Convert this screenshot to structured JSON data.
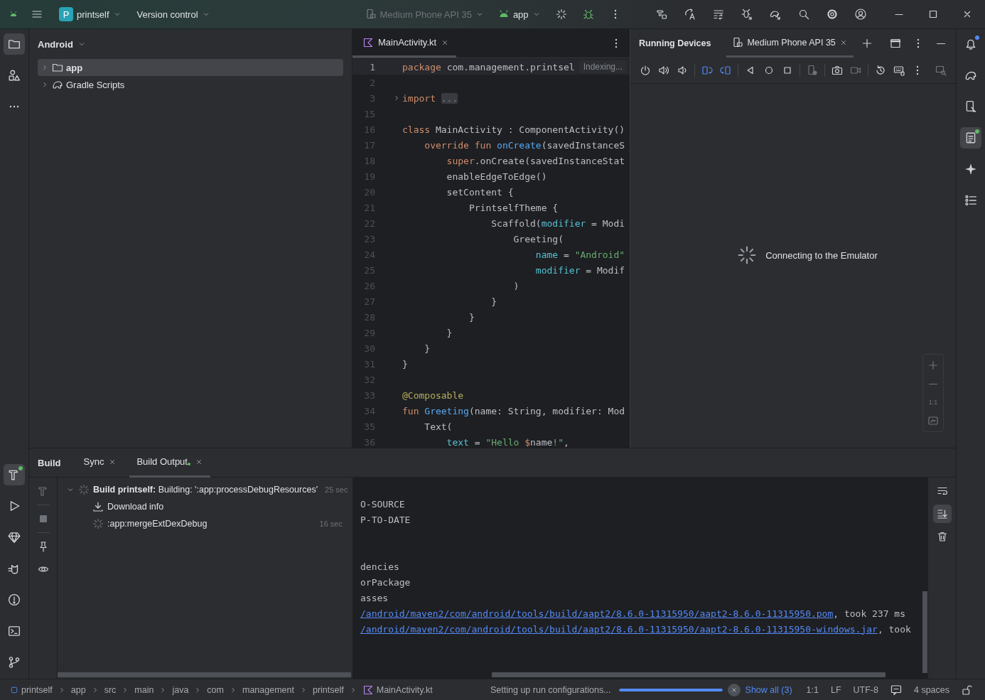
{
  "title_bar": {
    "project_initial": "P",
    "project": "printself",
    "vcs": "Version control",
    "device": "Medium Phone API 35",
    "device_disabled": true,
    "run_config": "app"
  },
  "project_panel": {
    "view": "Android",
    "tree": [
      {
        "label": "app",
        "kind": "module",
        "selected": true,
        "expanded": false
      },
      {
        "label": "Gradle Scripts",
        "kind": "gradle",
        "selected": false,
        "expanded": false
      }
    ]
  },
  "editor": {
    "tabs": [
      {
        "label": "MainActivity.kt",
        "selected": true
      }
    ],
    "badge": "Indexing...",
    "lines": [
      {
        "number": "1",
        "current": true,
        "tokens": [
          {
            "kind": "kw",
            "t": "package "
          },
          {
            "kind": "plain",
            "t": "com.management.printsel"
          }
        ]
      },
      {
        "number": "2",
        "current": false
      },
      {
        "number": "3",
        "current": false,
        "folded": true,
        "tokens": [
          {
            "kind": "kw",
            "t": "import "
          },
          {
            "kind": "fold",
            "t": "..."
          }
        ]
      },
      {
        "number": "15",
        "current": false
      },
      {
        "number": "16",
        "current": false,
        "tokens": [
          {
            "kind": "kw",
            "t": "class "
          },
          {
            "kind": "plain",
            "t": "MainActivity : ComponentActivity()"
          }
        ]
      },
      {
        "number": "17",
        "current": false,
        "tokens": [
          {
            "kind": "kw",
            "t": "    override fun "
          },
          {
            "kind": "fn",
            "t": "onCreate"
          },
          {
            "kind": "plain",
            "t": "(savedInstanceS"
          }
        ]
      },
      {
        "number": "18",
        "current": false,
        "tokens": [
          {
            "kind": "kw",
            "t": "        super"
          },
          {
            "kind": "plain",
            "t": ".onCreate(savedInstanceStat"
          }
        ]
      },
      {
        "number": "19",
        "current": false,
        "tokens": [
          {
            "kind": "plain",
            "t": "        enableEdgeToEdge()"
          }
        ]
      },
      {
        "number": "20",
        "current": false,
        "tokens": [
          {
            "kind": "plain",
            "t": "        setContent {"
          }
        ]
      },
      {
        "number": "21",
        "current": false,
        "tokens": [
          {
            "kind": "plain",
            "t": "            PrintselfTheme {"
          }
        ]
      },
      {
        "number": "22",
        "current": false,
        "tokens": [
          {
            "kind": "plain",
            "t": "                Scaffold("
          },
          {
            "kind": "param",
            "t": "modifier"
          },
          {
            "kind": "plain",
            "t": " = Modi"
          }
        ]
      },
      {
        "number": "23",
        "current": false,
        "tokens": [
          {
            "kind": "plain",
            "t": "                    Greeting("
          }
        ]
      },
      {
        "number": "24",
        "current": false,
        "tokens": [
          {
            "kind": "param",
            "t": "                        name"
          },
          {
            "kind": "plain",
            "t": " = "
          },
          {
            "kind": "str",
            "t": "\"Android\""
          }
        ]
      },
      {
        "number": "25",
        "current": false,
        "tokens": [
          {
            "kind": "param",
            "t": "                        modifier"
          },
          {
            "kind": "plain",
            "t": " = Modif"
          }
        ]
      },
      {
        "number": "26",
        "current": false,
        "tokens": [
          {
            "kind": "plain",
            "t": "                    )"
          }
        ]
      },
      {
        "number": "27",
        "current": false,
        "tokens": [
          {
            "kind": "plain",
            "t": "                }"
          }
        ]
      },
      {
        "number": "28",
        "current": false,
        "tokens": [
          {
            "kind": "plain",
            "t": "            }"
          }
        ]
      },
      {
        "number": "29",
        "current": false,
        "tokens": [
          {
            "kind": "plain",
            "t": "        }"
          }
        ]
      },
      {
        "number": "30",
        "current": false,
        "tokens": [
          {
            "kind": "plain",
            "t": "    }"
          }
        ]
      },
      {
        "number": "31",
        "current": false,
        "tokens": [
          {
            "kind": "plain",
            "t": "}"
          }
        ]
      },
      {
        "number": "32",
        "current": false
      },
      {
        "number": "33",
        "current": false,
        "tokens": [
          {
            "kind": "ann",
            "t": "@Composable"
          }
        ]
      },
      {
        "number": "34",
        "current": false,
        "tokens": [
          {
            "kind": "kw",
            "t": "fun "
          },
          {
            "kind": "fn",
            "t": "Greeting"
          },
          {
            "kind": "plain",
            "t": "(name: String, modifier: Mod"
          }
        ]
      },
      {
        "number": "35",
        "current": false,
        "tokens": [
          {
            "kind": "plain",
            "t": "    Text("
          }
        ]
      },
      {
        "number": "36",
        "current": false,
        "tokens": [
          {
            "kind": "param",
            "t": "        text"
          },
          {
            "kind": "plain",
            "t": " = "
          },
          {
            "kind": "str",
            "t": "\"Hello "
          },
          {
            "kind": "kw",
            "t": "$"
          },
          {
            "kind": "plain",
            "t": "name"
          },
          {
            "kind": "str",
            "t": "!\""
          },
          {
            "kind": "plain",
            "t": ","
          }
        ]
      }
    ]
  },
  "running_devices": {
    "title": "Running Devices",
    "tabs": [
      {
        "label": "Medium Phone API 35",
        "selected": true
      }
    ],
    "status": "Connecting to the Emulator",
    "zoom_label": "1:1"
  },
  "build": {
    "title": "Build",
    "tabs": [
      {
        "label": "Sync",
        "selected": false,
        "unread": false
      },
      {
        "label": "Build Output",
        "selected": true,
        "unread": true
      }
    ],
    "tree": [
      {
        "kind": "running",
        "text": "**Build printself:** Building: ':app:processDebugResources'",
        "time": "25 sec",
        "expanded": true,
        "children": [
          {
            "kind": "download",
            "text": "Download info"
          },
          {
            "kind": "running",
            "text": ":app:mergeExtDexDebug",
            "time": "16 sec"
          }
        ]
      }
    ],
    "console": [
      {
        "gap_before": false,
        "parts": [
          {
            "kind": "plain",
            "t": "O-SOURCE"
          }
        ]
      },
      {
        "gap_before": false,
        "parts": [
          {
            "kind": "plain",
            "t": "P-TO-DATE"
          }
        ]
      },
      {
        "gap_before": true,
        "parts": [
          {
            "kind": "plain",
            "t": "dencies"
          }
        ]
      },
      {
        "gap_before": false,
        "parts": [
          {
            "kind": "plain",
            "t": "orPackage"
          }
        ]
      },
      {
        "gap_before": false,
        "parts": [
          {
            "kind": "plain",
            "t": "asses"
          }
        ]
      },
      {
        "gap_before": false,
        "parts": [
          {
            "kind": "link",
            "t": "/android/maven2/com/android/tools/build/aapt2/8.6.0-11315950/aapt2-8.6.0-11315950.pom"
          },
          {
            "kind": "plain",
            "t": ", took 237 ms"
          }
        ]
      },
      {
        "gap_before": false,
        "parts": [
          {
            "kind": "link",
            "t": "/android/maven2/com/android/tools/build/aapt2/8.6.0-11315950/aapt2-8.6.0-11315950-windows.jar"
          },
          {
            "kind": "plain",
            "t": ", took"
          }
        ]
      }
    ]
  },
  "status_bar": {
    "breadcrumbs": [
      {
        "label": "printself",
        "kind": "module"
      },
      {
        "label": "app",
        "kind": "folder"
      },
      {
        "label": "src",
        "kind": "folder"
      },
      {
        "label": "main",
        "kind": "folder"
      },
      {
        "label": "java",
        "kind": "folder"
      },
      {
        "label": "com",
        "kind": "folder"
      },
      {
        "label": "management",
        "kind": "folder"
      },
      {
        "label": "printself",
        "kind": "folder"
      },
      {
        "label": "MainActivity.kt",
        "kind": "kotlin"
      }
    ],
    "progress_text": "Setting up run configurations...",
    "level": 1,
    "show_all": "Show all (3)",
    "position": "1:1",
    "line_separator": "LF",
    "encoding": "UTF-8",
    "indent": "4 spaces"
  }
}
